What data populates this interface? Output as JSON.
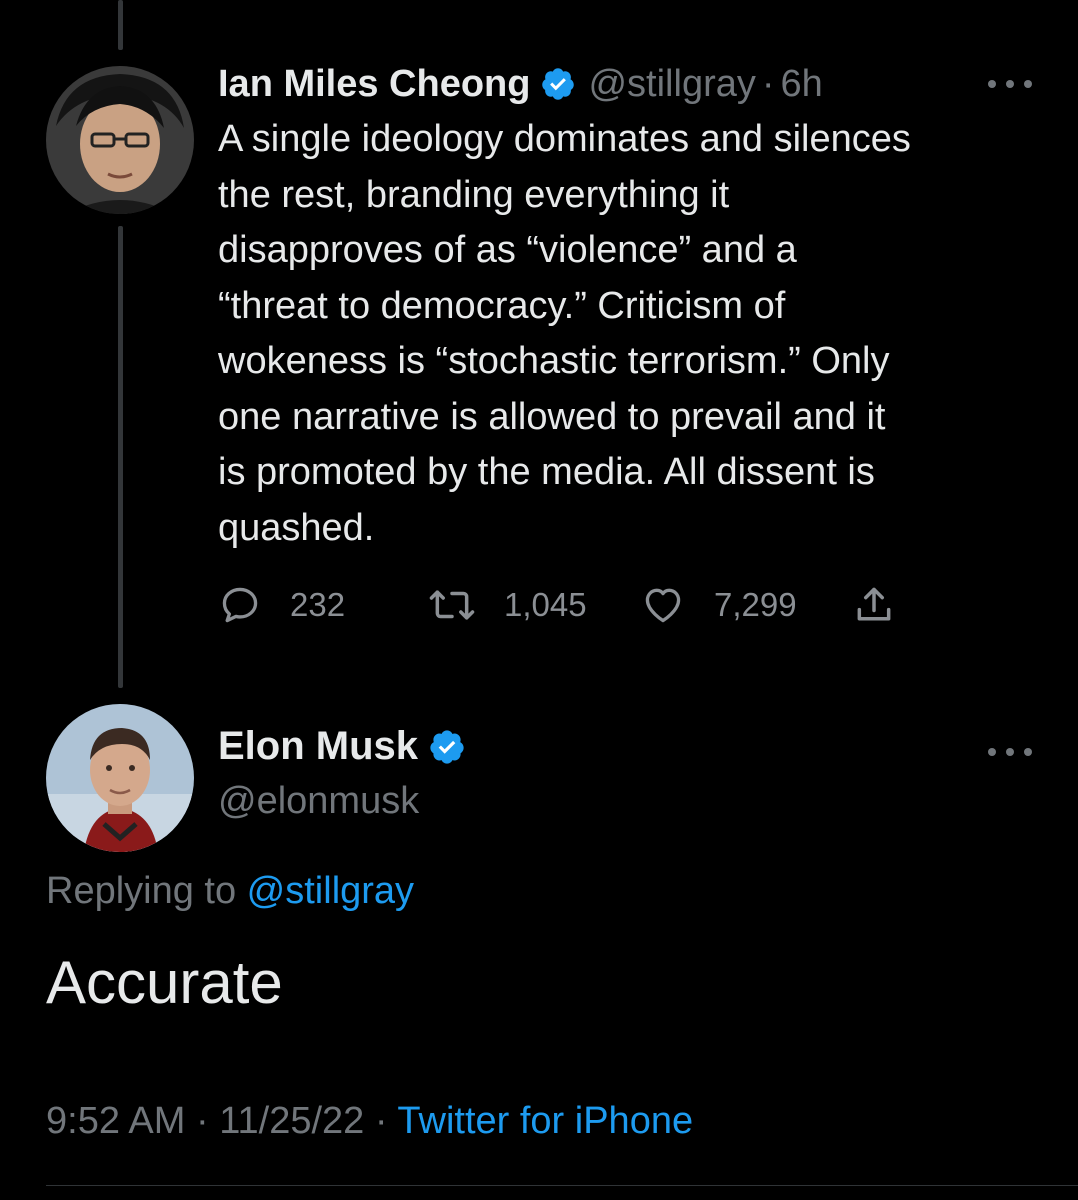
{
  "colors": {
    "background": "#000000",
    "text": "#e7e9ea",
    "secondary": "#71767b",
    "accent": "#1d9bf0"
  },
  "parent_tweet": {
    "author_name": "Ian Miles Cheong",
    "handle": "@stillgray",
    "separator": "·",
    "time": "6h",
    "text_lines": [
      "A single ideology dominates and silences",
      "the rest, branding everything it",
      "disapproves of as “violence” and a",
      "“threat to democracy.” Criticism of",
      "wokeness is “stochastic terrorism.” Only",
      "one narrative is allowed to prevail and it",
      "is promoted by the media. All dissent is",
      "quashed."
    ],
    "replies": "232",
    "retweets": "1,045",
    "likes": "7,299",
    "icons": [
      "verified-badge-icon",
      "reply-icon",
      "retweet-icon",
      "like-icon",
      "share-icon",
      "more-icon"
    ]
  },
  "reply_tweet": {
    "author_name": "Elon Musk",
    "handle": "@elonmusk",
    "replying_prefix": "Replying to ",
    "replying_to": "@stillgray",
    "text": "Accurate",
    "timestamp": "9:52 AM",
    "date": "11/25/22",
    "separator": "·",
    "source": "Twitter for iPhone",
    "icons": [
      "verified-badge-icon",
      "more-icon"
    ]
  }
}
